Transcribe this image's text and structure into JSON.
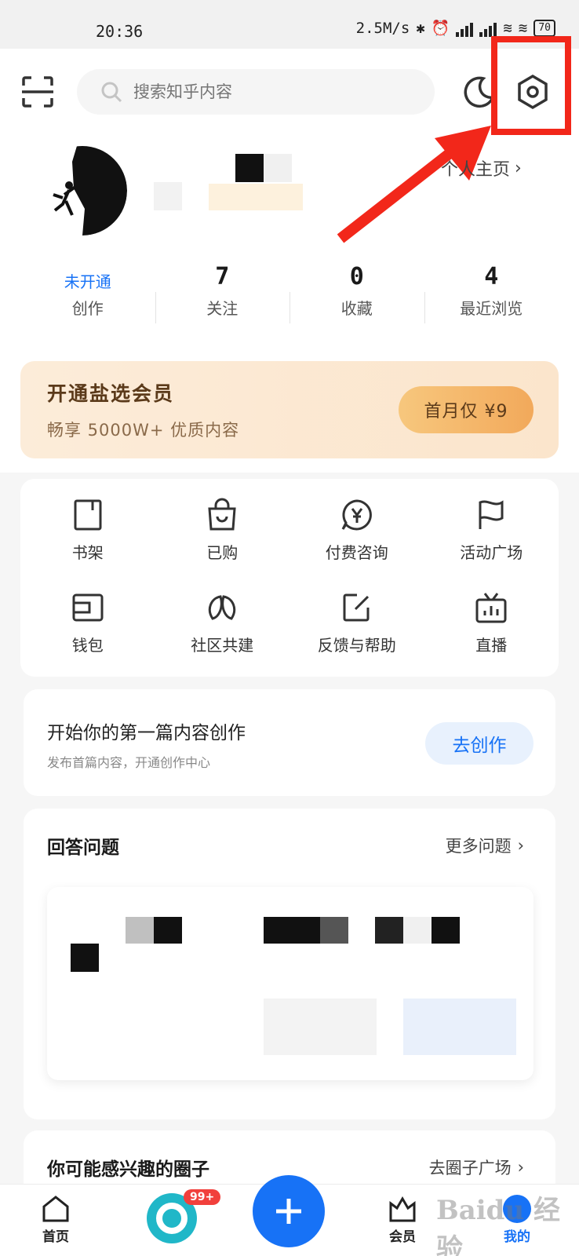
{
  "status_bar": {
    "time": "20:36",
    "net_speed": "2.5M/s",
    "battery": "70"
  },
  "header": {
    "search_placeholder": "搜索知乎内容"
  },
  "profile": {
    "link_label": "个人主页"
  },
  "stats": [
    {
      "value": "未开通",
      "label": "创作"
    },
    {
      "value": "7",
      "label": "关注"
    },
    {
      "value": "0",
      "label": "收藏"
    },
    {
      "value": "4",
      "label": "最近浏览"
    }
  ],
  "vip_banner": {
    "title": "开通盐选会员",
    "subtitle": "畅享 5000W+ 优质内容",
    "button": "首月仅 ¥9"
  },
  "grid": [
    {
      "label": "书架",
      "icon": "bookshelf-icon"
    },
    {
      "label": "已购",
      "icon": "shopping-bag-icon"
    },
    {
      "label": "付费咨询",
      "icon": "paid-consult-icon"
    },
    {
      "label": "活动广场",
      "icon": "flag-icon"
    },
    {
      "label": "钱包",
      "icon": "wallet-icon"
    },
    {
      "label": "社区共建",
      "icon": "community-icon"
    },
    {
      "label": "反馈与帮助",
      "icon": "feedback-icon"
    },
    {
      "label": "直播",
      "icon": "live-tv-icon"
    }
  ],
  "create_card": {
    "title": "开始你的第一篇内容创作",
    "subtitle": "发布首篇内容，开通创作中心",
    "button": "去创作"
  },
  "answer_section": {
    "title": "回答问题",
    "more": "更多问题"
  },
  "circle_section": {
    "title": "你可能感兴趣的圈子",
    "more": "去圈子广场"
  },
  "bottom_nav": {
    "home": "首页",
    "badge": "99+",
    "vip": "会员",
    "mine": "我的"
  },
  "colors": {
    "accent": "#1772f6",
    "highlight": "#f2271a",
    "vip_button": "#f2a95b"
  }
}
